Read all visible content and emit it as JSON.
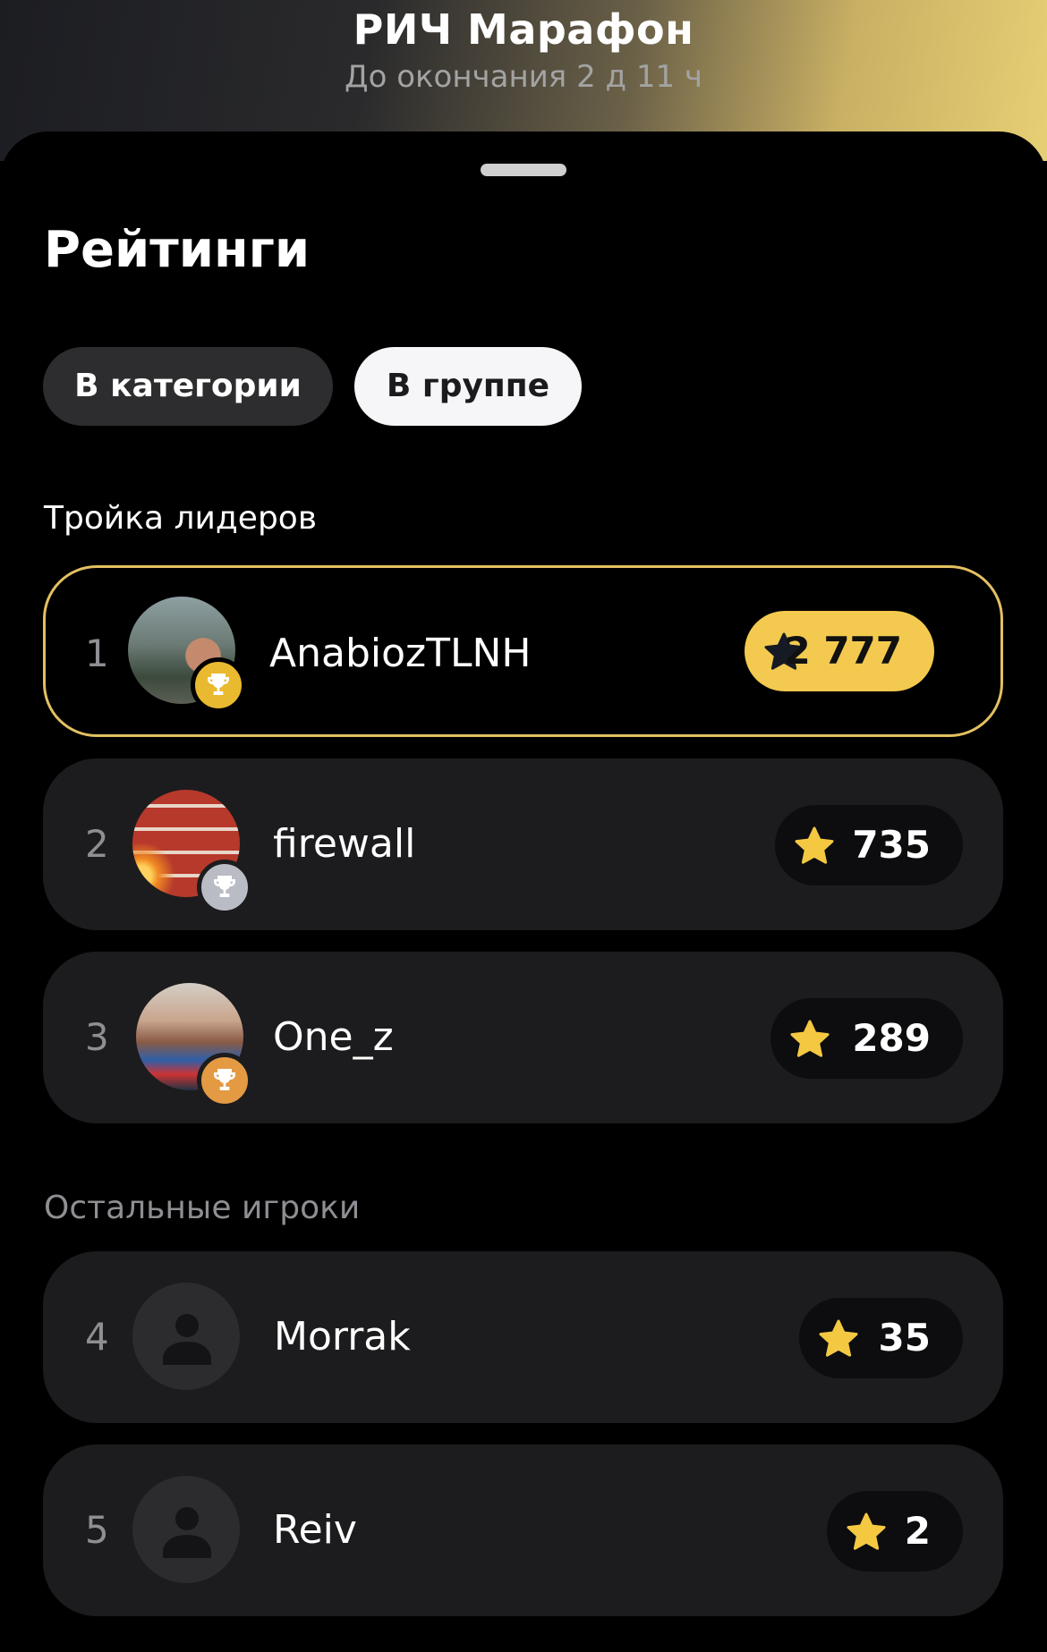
{
  "header": {
    "title": "РИЧ Марафон",
    "subtitle": "До окончания 2 д 11 ч"
  },
  "page_title": "Рейтинги",
  "tabs": [
    {
      "label": "В категории",
      "selected": false
    },
    {
      "label": "В группе",
      "selected": true
    }
  ],
  "sections": {
    "leaders_label": "Тройка лидеров",
    "others_label": "Остальные игроки"
  },
  "leaders": [
    {
      "rank": "1",
      "name": "AnabiozTLNH",
      "score": "2 777",
      "badge": "gold-trophy-icon"
    },
    {
      "rank": "2",
      "name": "firewall",
      "score": "735",
      "badge": "silver-trophy-icon"
    },
    {
      "rank": "3",
      "name": "One_z",
      "score": "289",
      "badge": "bronze-trophy-icon"
    }
  ],
  "others": [
    {
      "rank": "4",
      "name": "Morrak",
      "score": "35"
    },
    {
      "rank": "5",
      "name": "Reiv",
      "score": "2"
    }
  ],
  "colors": {
    "accent_gold": "#f3ca4f",
    "row_bg": "#1c1c1e",
    "highlight_border": "#e3c061",
    "star": "#f5c842"
  }
}
